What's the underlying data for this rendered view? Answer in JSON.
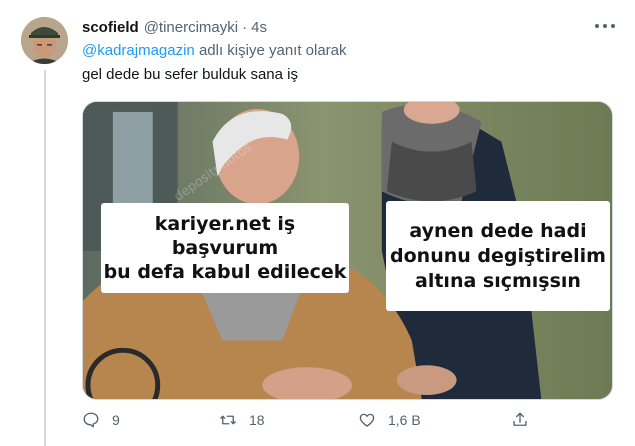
{
  "tweet": {
    "display_name": "scofield",
    "handle": "@tinercimayki",
    "separator": "·",
    "time": "4s",
    "reply_mention": "@kadrajmagazin",
    "reply_suffix": " adlı kişiye yanıt olarak",
    "text": "gel dede bu sefer bulduk sana iş"
  },
  "media": {
    "watermark": "depositphotos",
    "caption_left": [
      "kariyer.net iş başvurum",
      "bu defa kabul edilecek"
    ],
    "caption_right": [
      "aynen dede hadi",
      "donunu degiştirelim",
      "altına sıçmışsın"
    ]
  },
  "actions": {
    "reply_count": "9",
    "retweet_count": "18",
    "like_count": "1,6 B",
    "share_label": ""
  },
  "icons": {
    "more": "more-horizontal-icon",
    "reply": "reply-icon",
    "retweet": "retweet-icon",
    "like": "heart-icon",
    "share": "share-icon"
  },
  "colors": {
    "link": "#1d9bf0",
    "secondary_text": "#536471",
    "primary_text": "#0f1419",
    "divider": "#cfd9de"
  }
}
